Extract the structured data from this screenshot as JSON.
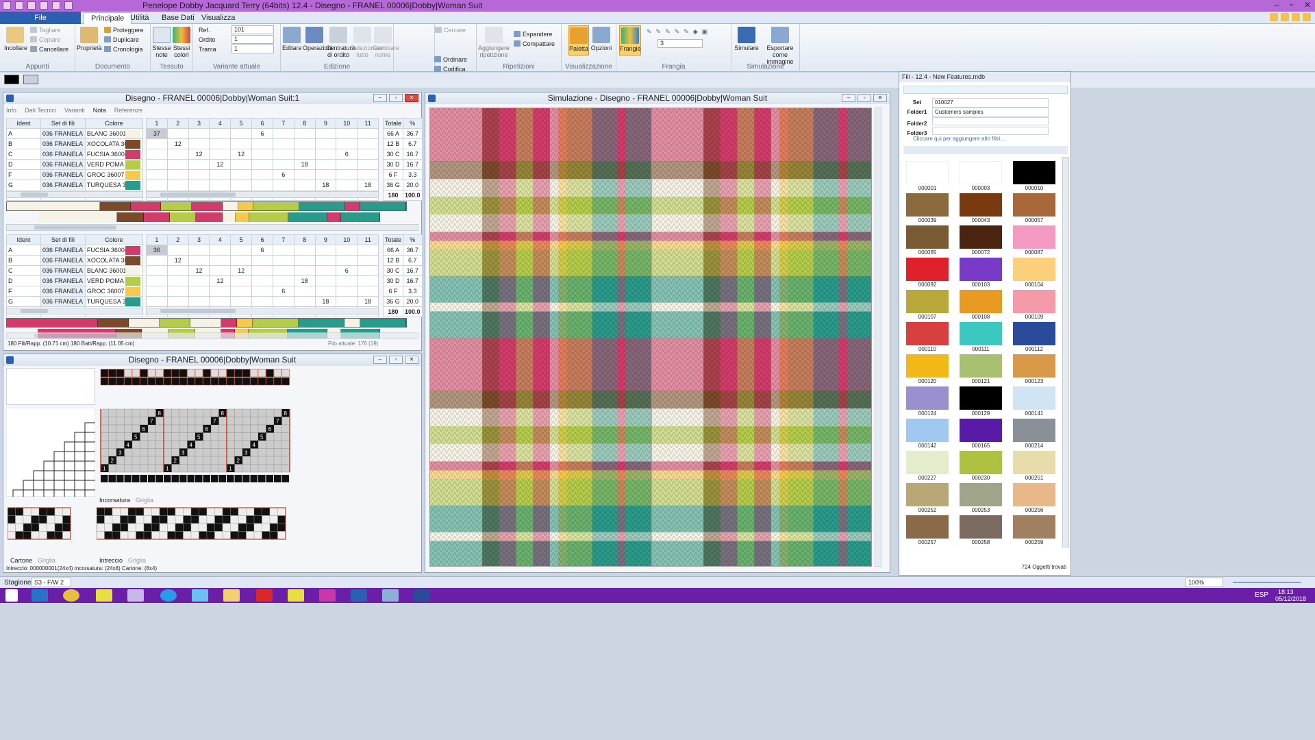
{
  "app": {
    "title": "Penelope Dobby Jacquard Terry (64bits) 12.4 - Disegno - FRANEL 00006|Dobby|Woman Suit"
  },
  "tabs": [
    "File",
    "Principale",
    "Utilità",
    "Base Dati",
    "Visualizza"
  ],
  "ribbon": {
    "groups": [
      {
        "label": "Appunti",
        "big": [
          "Incollare"
        ],
        "small": [
          "Tagliare",
          "Copiare",
          "Cancellare"
        ]
      },
      {
        "label": "Documento",
        "big": [
          "Proprietà"
        ],
        "small": [
          "Proteggere",
          "Duplicare",
          "Cronologia"
        ]
      },
      {
        "label": "Tessuto",
        "big": [
          "Stesse note",
          "Stessi colori"
        ]
      },
      {
        "label": "Variante attuale",
        "fields": [
          {
            "label": "Ref.",
            "value": "101"
          },
          {
            "label": "Ordito",
            "value": "1"
          },
          {
            "label": "Trama",
            "value": "1"
          }
        ]
      },
      {
        "label": "Edizione",
        "big": [
          "Editare",
          "Operazioni",
          "Centratura di ordito",
          "Selezionare tutto",
          "Cambiare nome"
        ],
        "small": [
          "Cercare",
          "Ordinare",
          "Codifica"
        ]
      },
      {
        "label": "Ripetizioni",
        "big": [
          "Aggiungere ripetizione"
        ],
        "small": [
          "Espandere",
          "Compattare"
        ]
      },
      {
        "label": "Visualizzazione",
        "big": [
          "Paletta",
          "Opzioni"
        ]
      },
      {
        "label": "Frangia",
        "big": [
          "Frangie"
        ],
        "spin": "3"
      },
      {
        "label": "Simulazione",
        "big": [
          "Simulare",
          "Esportare come immagine"
        ]
      }
    ]
  },
  "win1": {
    "title": "Disegno - FRANEL 00006|Dobby|Woman Suit:1",
    "tabs": [
      "Info",
      "Dati Tecnici",
      "Varianti",
      "Nota",
      "Referenze"
    ],
    "cols": [
      "Ident",
      "Set di fili",
      "Colore"
    ],
    "nums": [
      "1",
      "2",
      "3",
      "4",
      "5",
      "6",
      "7",
      "8",
      "9",
      "10",
      "11"
    ],
    "totcols": [
      "Totale",
      "%"
    ],
    "warp": [
      {
        "id": "A",
        "set": "036 FRANELA",
        "col": "BLANC 36001",
        "sw": "#f7f2e6",
        "v": [
          "37",
          "",
          "",
          "",
          "",
          "6",
          "",
          "",
          "",
          "",
          ""
        ],
        "tot": "66 A",
        "pct": "36.7"
      },
      {
        "id": "B",
        "set": "036 FRANELA",
        "col": "XOCOLATA 36009",
        "sw": "#7a4a2a",
        "v": [
          "",
          "12",
          "",
          "",
          "",
          "",
          "",
          "",
          "",
          "",
          ""
        ],
        "tot": "12 B",
        "pct": "6.7"
      },
      {
        "id": "C",
        "set": "036 FRANELA",
        "col": "FUCSIA 36004",
        "sw": "#d23c6a",
        "v": [
          "",
          "",
          "12",
          "",
          "12",
          "",
          "",
          "",
          "",
          "6",
          ""
        ],
        "tot": "30 C",
        "pct": "16.7"
      },
      {
        "id": "D",
        "set": "036 FRANELA",
        "col": "VERD POMA 360»",
        "sw": "#b5cc4a",
        "v": [
          "",
          "",
          "",
          "12",
          "",
          "",
          "",
          "18",
          "",
          "",
          ""
        ],
        "tot": "30 D",
        "pct": "16.7"
      },
      {
        "id": "F",
        "set": "036 FRANELA",
        "col": "GROC 36007",
        "sw": "#f5c94e",
        "v": [
          "",
          "",
          "",
          "",
          "",
          "",
          "6",
          "",
          "",
          "",
          ""
        ],
        "tot": "6 F",
        "pct": "3.3"
      },
      {
        "id": "G",
        "set": "036 FRANELA",
        "col": "TURQUESA 36010",
        "sw": "#2a9a8a",
        "v": [
          "",
          "",
          "",
          "",
          "",
          "",
          "",
          "",
          "18",
          "",
          "18"
        ],
        "tot": "36 G",
        "pct": "20.0"
      }
    ],
    "warp_total": [
      "180",
      "100.0"
    ],
    "weft": [
      {
        "id": "A",
        "set": "036 FRANELA",
        "col": "FUCSIA 36004",
        "sw": "#d23c6a",
        "v": [
          "36",
          "",
          "",
          "",
          "",
          "6",
          "",
          "",
          "",
          "",
          ""
        ],
        "tot": "66 A",
        "pct": "36.7"
      },
      {
        "id": "B",
        "set": "036 FRANELA",
        "col": "XOCOLATA 36009",
        "sw": "#7a4a2a",
        "v": [
          "",
          "12",
          "",
          "",
          "",
          "",
          "",
          "",
          "",
          "",
          ""
        ],
        "tot": "12 B",
        "pct": "6.7"
      },
      {
        "id": "C",
        "set": "036 FRANELA",
        "col": "BLANC 36001",
        "sw": "#f7f2e6",
        "v": [
          "",
          "",
          "12",
          "",
          "12",
          "",
          "",
          "",
          "",
          "6",
          ""
        ],
        "tot": "30 C",
        "pct": "16.7"
      },
      {
        "id": "D",
        "set": "036 FRANELA",
        "col": "VERD POMA 360»",
        "sw": "#b5cc4a",
        "v": [
          "",
          "",
          "",
          "12",
          "",
          "",
          "",
          "18",
          "",
          "",
          ""
        ],
        "tot": "30 D",
        "pct": "16.7"
      },
      {
        "id": "F",
        "set": "036 FRANELA",
        "col": "GROC 36007",
        "sw": "#f5c94e",
        "v": [
          "",
          "",
          "",
          "",
          "",
          "",
          "6",
          "",
          "",
          "",
          ""
        ],
        "tot": "6 F",
        "pct": "3.3"
      },
      {
        "id": "G",
        "set": "036 FRANELA",
        "col": "TURQUESA 36010",
        "sw": "#2a9a8a",
        "v": [
          "",
          "",
          "",
          "",
          "",
          "",
          "",
          "",
          "18",
          "",
          "18"
        ],
        "tot": "36 G",
        "pct": "20.0"
      }
    ],
    "weft_total": [
      "180",
      "100.0"
    ],
    "status_left": "180 Fili/Rapp. (10.71 cm)  180 Batt/Rapp. (11.05 cm)",
    "status_right": "Filo attuale: 176 (19)"
  },
  "win2": {
    "title": "Disegno - FRANEL 00006|Dobby|Woman Suit",
    "tabs_a": [
      "Incorsatura",
      "Griglia"
    ],
    "tabs_b": [
      "Cartone",
      "Griglia"
    ],
    "tabs_c": [
      "Intreccio",
      "Griglia"
    ],
    "marks": [
      "8",
      "7",
      "6",
      "5",
      "4",
      "3",
      "2",
      "1"
    ],
    "status": "Intreccio: 000000001(24x4) Incorsatura: (24x8) Cartone: (8x4)"
  },
  "sim": {
    "title": "Simulazione - Disegno - FRANEL 00006|Dobby|Woman Suit"
  },
  "fili": {
    "title": "Fili - 12.4 - New Features.mdb",
    "filters": [
      {
        "label": "Set",
        "value": "010027"
      },
      {
        "label": "Folder1",
        "value": "Customers samples"
      },
      {
        "label": "Folder2",
        "value": ""
      },
      {
        "label": "Folder3",
        "value": ""
      }
    ],
    "hint": "Cliccare qui per aggiungere altri filtri...",
    "swatches": [
      {
        "code": "000001",
        "color": "#ffffff"
      },
      {
        "code": "000003",
        "color": "#ffffff"
      },
      {
        "code": "000010",
        "color": "#000000"
      },
      {
        "code": "000039",
        "color": "#8b6a3e"
      },
      {
        "code": "000043",
        "color": "#7a3a10"
      },
      {
        "code": "000057",
        "color": "#a8683a"
      },
      {
        "code": "000065",
        "color": "#7a5a32"
      },
      {
        "code": "000072",
        "color": "#4a2410"
      },
      {
        "code": "000087",
        "color": "#f49ac2"
      },
      {
        "code": "000092",
        "color": "#e0202a"
      },
      {
        "code": "000103",
        "color": "#7a3ac8"
      },
      {
        "code": "000104",
        "color": "#fcd07a"
      },
      {
        "code": "000107",
        "color": "#b8a83a"
      },
      {
        "code": "000108",
        "color": "#e89a22"
      },
      {
        "code": "000109",
        "color": "#f59aa8"
      },
      {
        "code": "000110",
        "color": "#d84040"
      },
      {
        "code": "000111",
        "color": "#3ac8c0"
      },
      {
        "code": "000112",
        "color": "#2a4a9a"
      },
      {
        "code": "000120",
        "color": "#f2b818"
      },
      {
        "code": "000121",
        "color": "#a8c070"
      },
      {
        "code": "000123",
        "color": "#d89a48"
      },
      {
        "code": "000124",
        "color": "#9a90d0"
      },
      {
        "code": "000129",
        "color": "#000000"
      },
      {
        "code": "000141",
        "color": "#d0e4f4"
      },
      {
        "code": "000142",
        "color": "#a0c8f0"
      },
      {
        "code": "000165",
        "color": "#5a1aa8"
      },
      {
        "code": "000214",
        "color": "#8a9098"
      },
      {
        "code": "000227",
        "color": "#e4eccc"
      },
      {
        "code": "000230",
        "color": "#b0c040"
      },
      {
        "code": "000251",
        "color": "#e8dcaa"
      },
      {
        "code": "000252",
        "color": "#b8a878"
      },
      {
        "code": "000253",
        "color": "#a0a488"
      },
      {
        "code": "000256",
        "color": "#e8b888"
      },
      {
        "code": "000257",
        "color": "#8a6a48"
      },
      {
        "code": "000258",
        "color": "#7a6a60"
      },
      {
        "code": "000259",
        "color": "#a08060"
      }
    ],
    "count": "724 Oggetti trovati"
  },
  "statusbar": {
    "stagione_label": "Stagione",
    "stagione_value": "S3 - F/W 2",
    "zoom": "100%"
  },
  "taskbar": {
    "lang": "ESP",
    "time": "18:13",
    "date": "05/12/2018"
  }
}
